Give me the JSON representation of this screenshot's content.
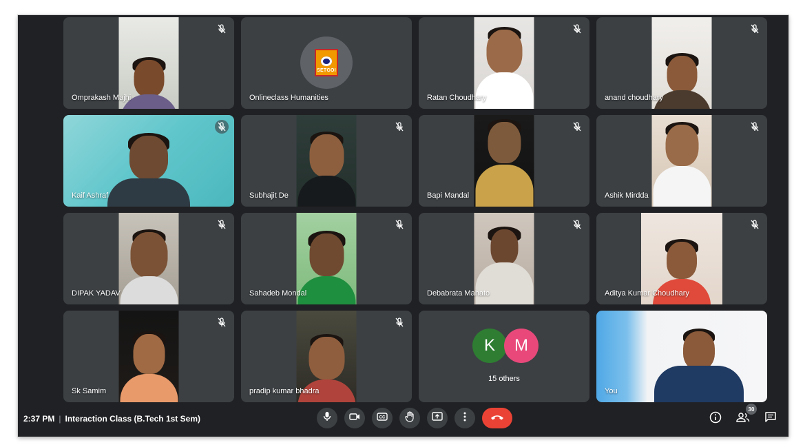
{
  "meeting": {
    "time": "2:37 PM",
    "separator": "|",
    "title": "Interaction Class (B.Tech 1st Sem)"
  },
  "tiles": [
    {
      "name": "Omprakash Majhi",
      "muted": true
    },
    {
      "name": "Onlineclass Humanities",
      "logo_text": "SETGOI"
    },
    {
      "name": "Ratan Choudhary",
      "muted": true
    },
    {
      "name": "anand choudhary",
      "muted": true
    },
    {
      "name": "Kaif Ashraf",
      "muted": true
    },
    {
      "name": "Subhajit De",
      "muted": true
    },
    {
      "name": "Bapi Mandal",
      "muted": true
    },
    {
      "name": "Ashik Mirdda",
      "muted": true
    },
    {
      "name": "DIPAK YADAV",
      "muted": true
    },
    {
      "name": "Sahadeb Mondal",
      "muted": true
    },
    {
      "name": "Debabrata Mahato",
      "muted": true
    },
    {
      "name": "Aditya Kumar Choudhary",
      "muted": true
    },
    {
      "name": "Sk Samim",
      "muted": true
    },
    {
      "name": "pradip kumar bhadra",
      "muted": true
    },
    {
      "name": "15 others",
      "avatars": [
        {
          "letter": "K",
          "color": "#2e7d32"
        },
        {
          "letter": "M",
          "color": "#e8497a"
        }
      ]
    },
    {
      "name": "You"
    }
  ],
  "participants_count": "30",
  "colors": {
    "background": "#202124",
    "tile": "#3c4043",
    "end_call": "#ea4335"
  },
  "icons": {
    "controls": [
      "microphone-icon",
      "camera-icon",
      "captions-icon",
      "raise-hand-icon",
      "present-screen-icon",
      "more-options-icon",
      "end-call-icon"
    ],
    "right": [
      "info-icon",
      "people-icon",
      "chat-icon"
    ]
  }
}
